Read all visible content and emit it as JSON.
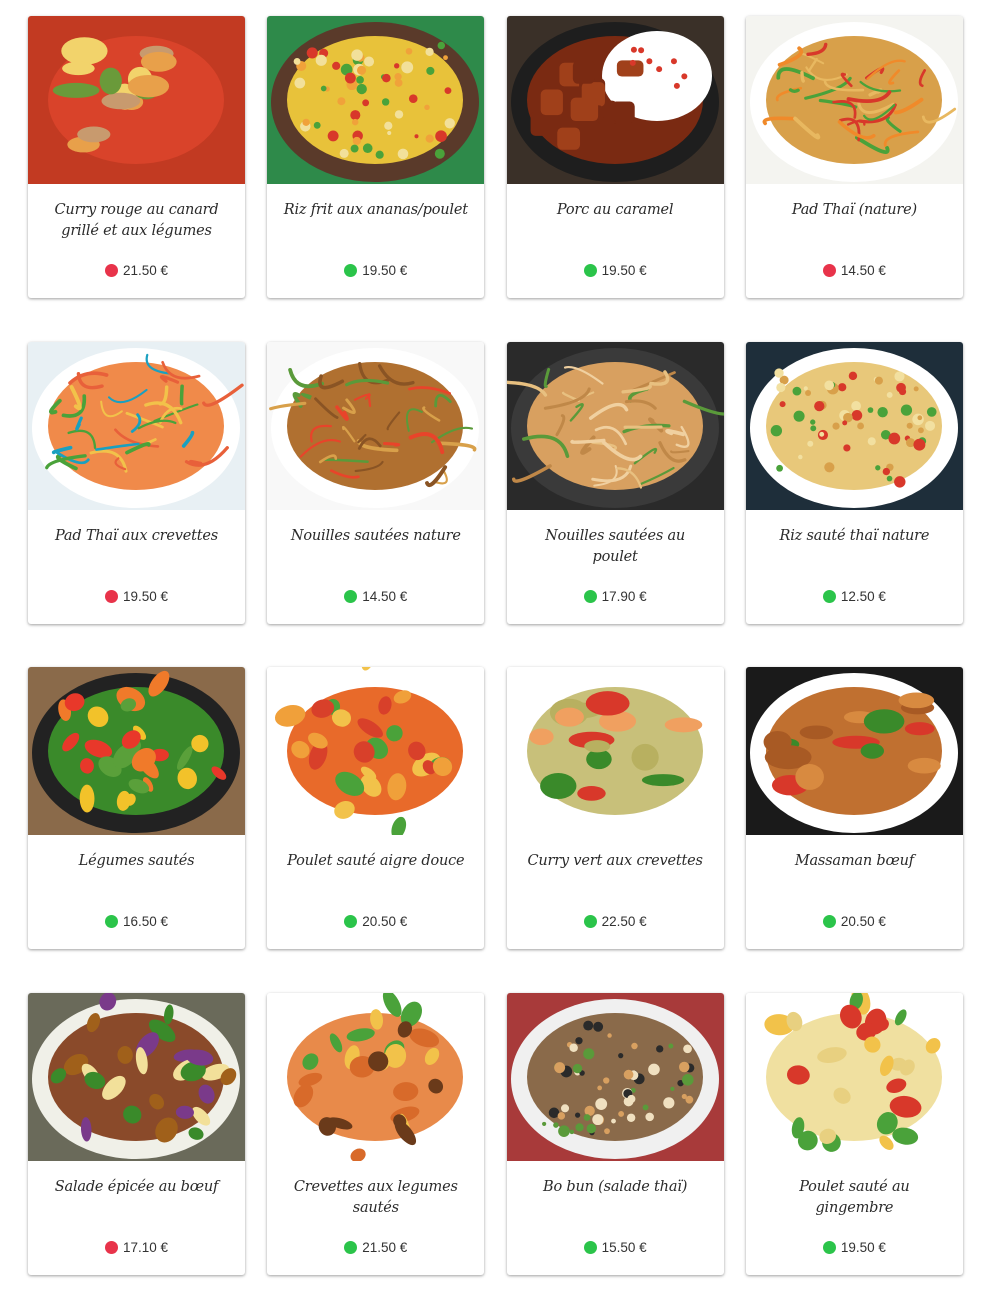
{
  "colors": {
    "spicy": "#e8334a",
    "mild": "#2bc44a"
  },
  "items": [
    {
      "name": "Curry rouge au canard grillé et aux légumes",
      "price": "21.50 €",
      "indicator": "spicy",
      "icon": "curry-duck-photo"
    },
    {
      "name": "Riz frit aux ananas/poulet",
      "price": "19.50 €",
      "indicator": "mild",
      "icon": "fried-rice-pineapple-photo"
    },
    {
      "name": "Porc au caramel",
      "price": "19.50 €",
      "indicator": "mild",
      "icon": "caramel-pork-photo"
    },
    {
      "name": "Pad Thaï (nature)",
      "price": "14.50 €",
      "indicator": "spicy",
      "icon": "pad-thai-photo"
    },
    {
      "name": "Pad Thaï aux crevettes",
      "price": "19.50 €",
      "indicator": "spicy",
      "icon": "pad-thai-shrimp-photo"
    },
    {
      "name": "Nouilles sautées nature",
      "price": "14.50 €",
      "indicator": "mild",
      "icon": "stir-fried-noodles-photo"
    },
    {
      "name": "Nouilles sautées au poulet",
      "price": "17.90 €",
      "indicator": "mild",
      "icon": "chicken-noodles-photo"
    },
    {
      "name": "Riz sauté thaï nature",
      "price": "12.50 €",
      "indicator": "mild",
      "icon": "thai-fried-rice-photo"
    },
    {
      "name": "Légumes sautés",
      "price": "16.50 €",
      "indicator": "mild",
      "icon": "sauteed-vegetables-photo"
    },
    {
      "name": "Poulet sauté aigre douce",
      "price": "20.50 €",
      "indicator": "mild",
      "icon": "sweet-sour-chicken-photo"
    },
    {
      "name": "Curry vert aux crevettes",
      "price": "22.50 €",
      "indicator": "mild",
      "icon": "green-curry-shrimp-photo"
    },
    {
      "name": "Massaman bœuf",
      "price": "20.50 €",
      "indicator": "mild",
      "icon": "massaman-beef-photo"
    },
    {
      "name": "Salade épicée au bœuf",
      "price": "17.10 €",
      "indicator": "spicy",
      "icon": "spicy-beef-salad-photo"
    },
    {
      "name": "Crevettes aux legumes sautés",
      "price": "21.50 €",
      "indicator": "mild",
      "icon": "shrimp-vegetables-photo"
    },
    {
      "name": "Bo bun (salade thaï)",
      "price": "15.50 €",
      "indicator": "mild",
      "icon": "bo-bun-photo"
    },
    {
      "name": "Poulet sauté au gingembre",
      "price": "19.50 €",
      "indicator": "mild",
      "icon": "ginger-chicken-photo"
    }
  ]
}
